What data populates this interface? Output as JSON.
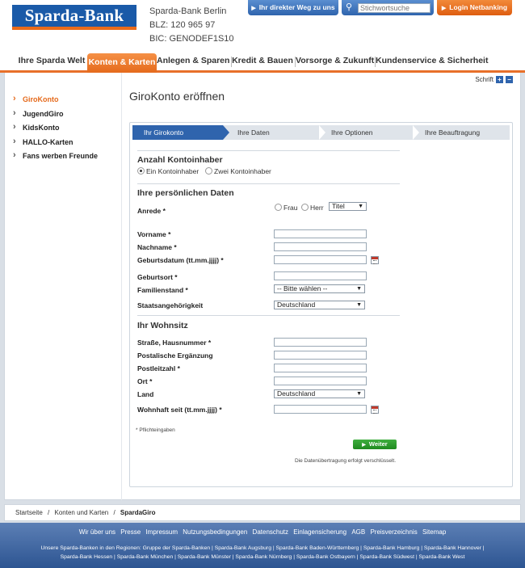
{
  "header": {
    "logo": "Sparda-Bank",
    "bank_name": "Sparda-Bank Berlin",
    "blz": "BLZ: 120 965 97",
    "bic": "BIC: GENODEF1S10",
    "way_button": "Ihr direkter Weg zu uns",
    "search_placeholder": "Stichwortsuche",
    "login_button": "Login Netbanking"
  },
  "nav": [
    {
      "label": "Ihre Sparda Welt"
    },
    {
      "label": "Konten & Karten"
    },
    {
      "label": "Anlegen & Sparen"
    },
    {
      "label": "Kredit & Bauen"
    },
    {
      "label": "Vorsorge & Zukunft"
    },
    {
      "label": "Kundenservice & Sicherheit"
    }
  ],
  "schrift_label": "Schrift",
  "sidebar": [
    {
      "label": "GiroKonto"
    },
    {
      "label": "JugendGiro"
    },
    {
      "label": "KidsKonto"
    },
    {
      "label": "HALLO-Karten"
    },
    {
      "label": "Fans werben Freunde"
    }
  ],
  "page_title": "GiroKonto eröffnen",
  "steps": [
    {
      "label": "Ihr Girokonto"
    },
    {
      "label": "Ihre Daten"
    },
    {
      "label": "Ihre Optionen"
    },
    {
      "label": "Ihre Beauftragung"
    }
  ],
  "form": {
    "holders_title": "Anzahl Kontoinhaber",
    "holder_one": "Ein Kontoinhaber",
    "holder_two": "Zwei Kontoinhaber",
    "personal_title": "Ihre persönlichen Daten",
    "anrede_label": "Anrede *",
    "frau": "Frau",
    "herr": "Herr",
    "titel_value": "Titel",
    "vorname": "Vorname *",
    "nachname": "Nachname *",
    "geburtsdatum": "Geburtsdatum (tt.mm.jjjj) *",
    "geburtsort": "Geburtsort *",
    "familienstand": "Familienstand *",
    "familienstand_value": "-- Bitte wählen --",
    "staatsangehoerigkeit": "Staatsangehörigkeit",
    "staatsangehoerigkeit_value": "Deutschland",
    "residence_title": "Ihr Wohnsitz",
    "strasse": "Straße, Hausnummer *",
    "postalische": "Postalische Ergänzung",
    "plz": "Postleitzahl *",
    "ort": "Ort *",
    "land": "Land",
    "land_value": "Deutschland",
    "wohnhaft": "Wohnhaft seit (tt.mm.jjjj) *",
    "required_note": "* Pflichteingaben",
    "next_button": "Weiter",
    "secure_note": "Die Datenübertragung erfolgt verschlüsselt."
  },
  "breadcrumb": {
    "home": "Startseite",
    "sep": "/",
    "section": "Konten und Karten",
    "current": "SpardaGiro"
  },
  "footer": {
    "links": [
      "Wir über uns",
      "Presse",
      "Impressum",
      "Nutzungsbedingungen",
      "Datenschutz",
      "Einlagensicherung",
      "AGB",
      "Preisverzeichnis",
      "Sitemap"
    ],
    "regions_line1": "Unsere Sparda-Banken in den Regionen:  Gruppe der Sparda-Banken  |  Sparda-Bank Augsburg  |  Sparda-Bank Baden-Württemberg  |  Sparda-Bank Hamburg  |  Sparda-Bank Hannover  |",
    "regions_line2": "Sparda-Bank Hessen  |  Sparda-Bank München  |  Sparda-Bank Münster  |  Sparda-Bank Nürnberg  |  Sparda-Bank Ostbayern  |  Sparda-Bank Südwest  |  Sparda-Bank West"
  }
}
